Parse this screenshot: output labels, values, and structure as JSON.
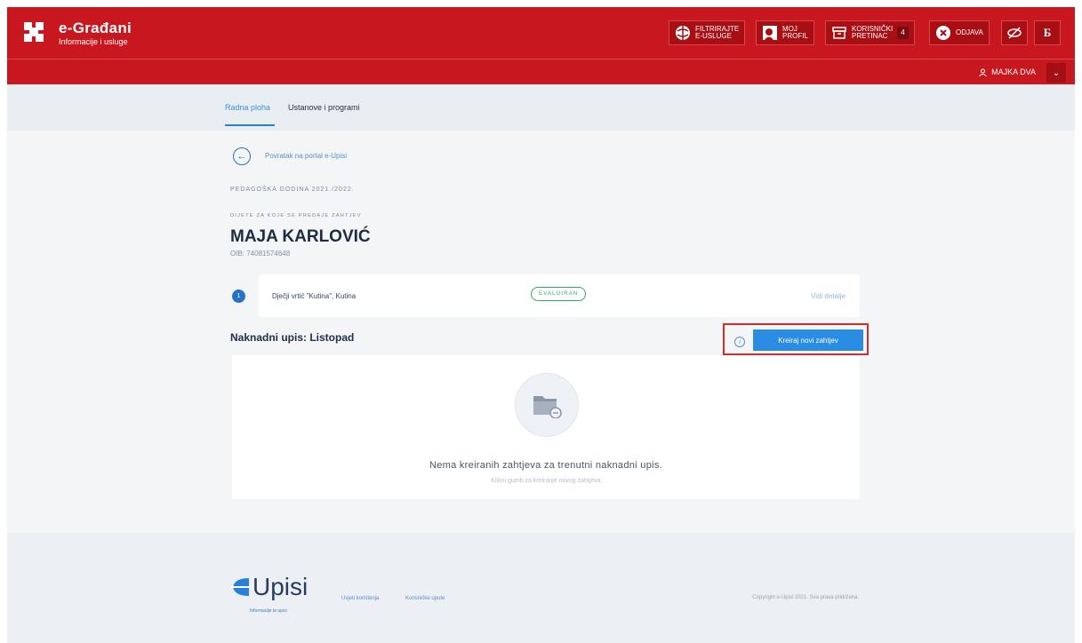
{
  "header": {
    "brand_title": "e-Građani",
    "brand_subtitle": "Informacije i usluge",
    "buttons": [
      {
        "label": "FILTRIRAJTE\nE-USLUGE",
        "icon": "globe-icon"
      },
      {
        "label": "MOJ\nPROFIL",
        "icon": "profile-icon"
      },
      {
        "label": "KORISNIČKI\nPRETINAC",
        "icon": "inbox-icon",
        "badge": "4"
      },
      {
        "label": "ODJAVA",
        "icon": "logout-icon"
      },
      {
        "label": "",
        "icon": "accessibility-icon"
      },
      {
        "label": "Б",
        "icon": "cyrillic-icon"
      }
    ],
    "user_name": "MAJKA DVA",
    "user_caret": "⌄"
  },
  "tabs": [
    {
      "label": "Radna ploha",
      "active": true
    },
    {
      "label": "Ustanove i programi",
      "active": false
    }
  ],
  "main": {
    "back_link": "Povratak na portal e-Upisi",
    "pedagoska_godina": "PEDAGOŠKA GODINA 2021./2022.",
    "child_label": "DIJETE ZA KOJE SE PREDAJE ZAHTJEV",
    "child_name": "MAJA KARLOVIĆ",
    "oib": "OIB: 74081574648",
    "kindergarten": {
      "number": "1",
      "name": "Dječji vrtić \"Kutina\", Kutina",
      "status": "EVALUIRAN",
      "details_link": "Vidi detalje"
    },
    "section_title": "Naknadni upis: Listopad",
    "info_glyph": "i",
    "create_button": "Kreiraj novi zahtjev",
    "empty_title": "Nema kreiranih zahtjeva za trenutni naknadni upis.",
    "empty_subtitle": "Klikni gumb za kreiranje novog zahtjeva"
  },
  "footer": {
    "logo_text": "Upisi",
    "logo_tagline": "Informacije te upisi",
    "links": [
      "Uvjeti korištenja",
      "Korisničke upute"
    ],
    "copyright": "Copyright e-Upisi 2021. Sva prava pridržana."
  },
  "colors": {
    "header_red": "#c8171e",
    "primary_blue": "#2a8ce2",
    "status_green": "#39a85f",
    "highlight_red": "#d42b2b"
  }
}
